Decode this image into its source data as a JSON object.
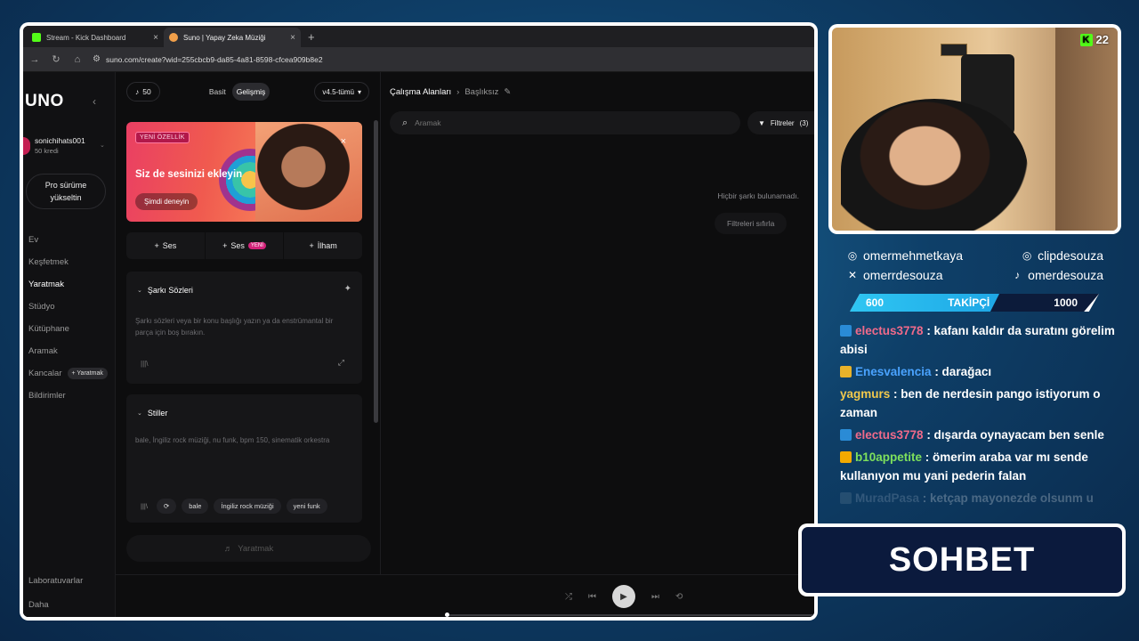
{
  "browser": {
    "tabs": [
      {
        "title": "Stream - Kick Dashboard",
        "fav_color": "#53fc18"
      },
      {
        "title": "Suno | Yapay Zeka Müziği",
        "fav_color": "#f2a04a"
      }
    ],
    "new_tab": "+",
    "url": "suno.com/create?wid=255cbcb9-da85-4a81-8598-cfcea909b8e2"
  },
  "suno": {
    "logo": "UNO",
    "user": {
      "name": "sonichihats001",
      "credits": "50 kredi"
    },
    "upgrade": "Pro sürüme yükseltin",
    "nav": [
      {
        "label": "Ev"
      },
      {
        "label": "Keşfetmek"
      },
      {
        "label": "Yaratmak",
        "active": true
      },
      {
        "label": "Stüdyo"
      },
      {
        "label": "Kütüphane"
      },
      {
        "label": "Aramak"
      },
      {
        "label": "Kancalar",
        "pill": "+ Yaratmak"
      },
      {
        "label": "Bildirimler"
      }
    ],
    "nav_bottom": [
      "Laboratuvarlar",
      "Daha"
    ],
    "credit_count": "50",
    "mode": {
      "basic": "Basit",
      "advanced": "Gelişmiş"
    },
    "version": "v4.5-tümü",
    "promo": {
      "badge": "YENİ ÖZELLİK",
      "title": "Siz de sesinizi ekleyin",
      "cta": "Şimdi deneyin"
    },
    "add_row": [
      {
        "label": "Ses"
      },
      {
        "label": "Ses",
        "tag": "YENİ"
      },
      {
        "label": "İlham"
      }
    ],
    "lyrics": {
      "title": "Şarkı Sözleri",
      "placeholder": "Şarkı sözleri veya bir konu başlığı yazın ya da enstrümantal bir parça için boş bırakın."
    },
    "styles": {
      "title": "Stiller",
      "placeholder": "bale, İngiliz rock müziği, nu funk, bpm 150, sinematik orkestra",
      "pills": [
        "bale",
        "İngiliz rock müziği",
        "yeni funk"
      ]
    },
    "create_button": "Yaratmak",
    "workspace": {
      "breadcrumb_root": "Çalışma Alanları",
      "breadcrumb_current": "Başlıksız",
      "search_placeholder": "Aramak",
      "filters": "Filtreler",
      "filter_count": "(3)",
      "empty_text": "Hiçbir şarkı bulunamadı.",
      "reset": "Filtreleri sıfırla"
    }
  },
  "stream": {
    "viewers": "22",
    "socials": [
      {
        "icon": "instagram-icon",
        "handle": "omermehmetkaya"
      },
      {
        "icon": "instagram-icon",
        "handle": "clipdesouza"
      },
      {
        "icon": "x-icon",
        "handle": "omerrdesouza"
      },
      {
        "icon": "tiktok-icon",
        "handle": "omerdesouza"
      }
    ],
    "followers": {
      "current": "600",
      "label": "TAKİPÇİ",
      "goal": "1000",
      "progress": 0.6
    },
    "chat": [
      {
        "user": "electus3778",
        "color": "#f06a8a",
        "badge": "#2a8bd6",
        "text": ": kafanı kaldır da suratını görelim abisi"
      },
      {
        "user": "Enesvalencia",
        "color": "#4aa3ff",
        "badge": "#e8b22a",
        "text": ": darağacı"
      },
      {
        "user": "yagmurs",
        "color": "#f2c94c",
        "badge": "",
        "text": ": ben de nerdesin pango istiyorum o zaman"
      },
      {
        "user": "electus3778",
        "color": "#f06a8a",
        "badge": "#2a8bd6",
        "text": ": dışarda oynayacam ben senle"
      },
      {
        "user": "b10appetite",
        "color": "#7ee05c",
        "badge": "#f2a900",
        "text": ": ömerim araba var mı sende kullanıyon mu yani pederin falan"
      },
      {
        "user": "MuradPasa",
        "color": "#9fb3c8",
        "badge": "#6f8aa0",
        "text": ": ketçap mayonezde olsunm u",
        "faded": true
      }
    ],
    "sohbet": "SOHBET"
  }
}
